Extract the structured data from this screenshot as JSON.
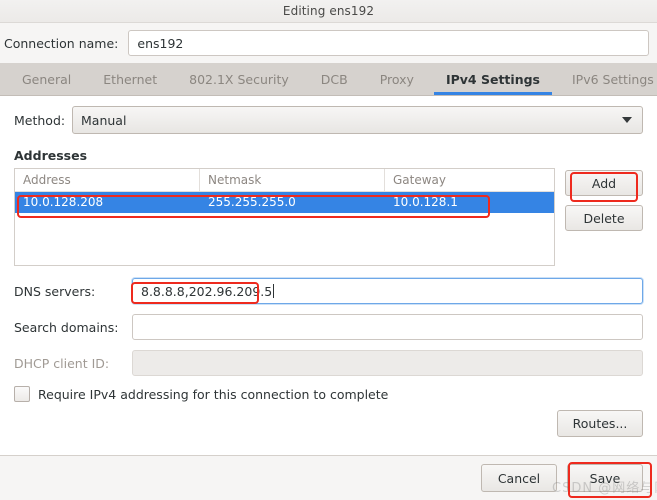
{
  "window": {
    "title": "Editing ens192"
  },
  "connection": {
    "label": "Connection name:",
    "value": "ens192"
  },
  "tabs": [
    {
      "label": "General",
      "active": false
    },
    {
      "label": "Ethernet",
      "active": false
    },
    {
      "label": "802.1X Security",
      "active": false
    },
    {
      "label": "DCB",
      "active": false
    },
    {
      "label": "Proxy",
      "active": false
    },
    {
      "label": "IPv4 Settings",
      "active": true
    },
    {
      "label": "IPv6 Settings",
      "active": false
    }
  ],
  "method": {
    "label": "Method:",
    "value": "Manual",
    "arrow_icon": "chevron-down-icon"
  },
  "addresses": {
    "section_title": "Addresses",
    "columns": [
      "Address",
      "Netmask",
      "Gateway"
    ],
    "rows": [
      {
        "address": "10.0.128.208",
        "netmask": "255.255.255.0",
        "gateway": "10.0.128.1",
        "selected": true
      }
    ],
    "add_label": "Add",
    "delete_label": "Delete"
  },
  "fields": {
    "dns": {
      "label": "DNS servers:",
      "value": "8.8.8.8,202.96.209.5",
      "placeholder": "",
      "focused": true
    },
    "search_domains": {
      "label": "Search domains:",
      "value": "",
      "placeholder": ""
    },
    "dhcp_client_id": {
      "label": "DHCP client ID:",
      "value": "",
      "placeholder": "",
      "disabled": true
    }
  },
  "require_ipv4": {
    "label": "Require IPv4 addressing for this connection to complete",
    "checked": false
  },
  "routes": {
    "label": "Routes..."
  },
  "actions": {
    "cancel_label": "Cancel",
    "save_label": "Save"
  },
  "watermark": {
    "text": "CSDN @网络与网"
  },
  "colors": {
    "selection_blue": "#3584e4",
    "annotation_red": "#ee2a1e",
    "window_bg": "#f6f5f4",
    "tabbar_bg": "#d6d2ce"
  }
}
